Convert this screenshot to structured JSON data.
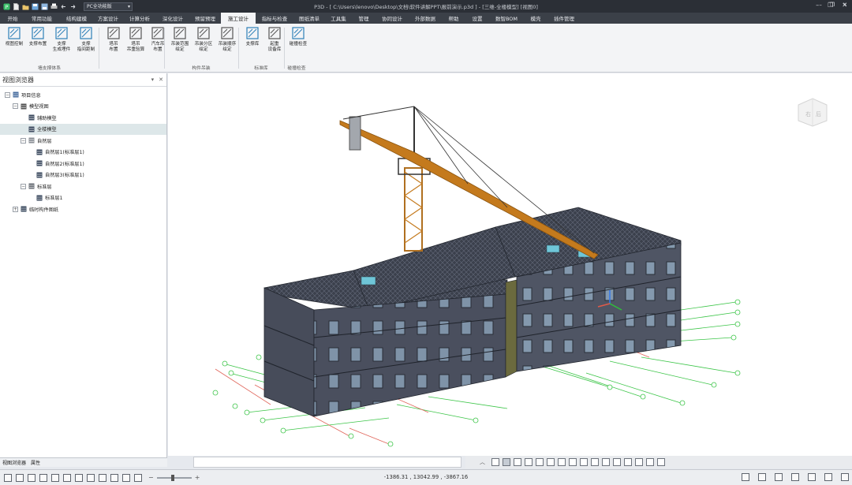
{
  "titlebar": {
    "workspace": "PC全功能版",
    "title": "P3D - [ C:\\Users\\lenovo\\Desktop\\文档\\软件讲解PPT\\报前演示.p3d ] - [三维-全楼模型] [视图0]"
  },
  "menu": {
    "tabs": [
      "开始",
      "常用功能",
      "结构建模",
      "方案设计",
      "计算分析",
      "深化设计",
      "预留预埋",
      "施工设计",
      "指标与检查",
      "图纸清单",
      "工具集",
      "管理",
      "协同设计",
      "外部数据",
      "帮助",
      "设置",
      "数智BOM",
      "模壳",
      "插件管理"
    ],
    "active": "施工设计"
  },
  "ribbon": {
    "buttons": [
      {
        "label": "视图控制",
        "icon": "view-control-icon"
      },
      {
        "label": "支撑布置",
        "icon": "support-layout-icon"
      },
      {
        "label": "支撑\n生成埋件",
        "icon": "support-embed-icon"
      },
      {
        "label": "支撑\n指间距制",
        "icon": "support-spacing-icon"
      },
      {
        "label": "塔吊\n布置",
        "icon": "tower-crane-icon"
      },
      {
        "label": "塔吊\n吊重验算",
        "icon": "crane-load-check-icon"
      },
      {
        "label": "汽车吊\n布置",
        "icon": "truck-crane-icon"
      },
      {
        "label": "吊装范围\n绘定",
        "icon": "hoist-range-icon"
      },
      {
        "label": "吊装分区\n绘定",
        "icon": "hoist-zone-icon"
      },
      {
        "label": "吊装顺序\n绘定",
        "icon": "hoist-order-icon"
      },
      {
        "label": "支撑库",
        "icon": "support-library-icon"
      },
      {
        "label": "起重\n设备库",
        "icon": "crane-equipment-library-icon"
      },
      {
        "label": "碰撞检查",
        "icon": "collision-check-icon"
      }
    ],
    "groups": [
      "墙支撑体系",
      "构件吊装",
      "标准库",
      "碰撞检查"
    ]
  },
  "browser": {
    "title": "视图浏览器",
    "tree": [
      {
        "label": "项目信息",
        "level": 0,
        "toggle": "⊟"
      },
      {
        "label": "模型视图",
        "level": 1,
        "toggle": "⊟"
      },
      {
        "label": "辅助模型",
        "level": 2,
        "toggle": ""
      },
      {
        "label": "全楼模型",
        "level": 2,
        "toggle": "",
        "selected": true
      },
      {
        "label": "自然层",
        "level": 2,
        "toggle": "⊟"
      },
      {
        "label": "自然层1(标准层1)",
        "level": 3,
        "toggle": ""
      },
      {
        "label": "自然层2(标准层1)",
        "level": 3,
        "toggle": ""
      },
      {
        "label": "自然层3(标准层1)",
        "level": 3,
        "toggle": ""
      },
      {
        "label": "标准层",
        "level": 2,
        "toggle": "⊟"
      },
      {
        "label": "标准层1",
        "level": 3,
        "toggle": ""
      },
      {
        "label": "临时构件图纸",
        "level": 1,
        "toggle": "⊞"
      }
    ],
    "tabs": [
      "视图浏览器",
      "属性"
    ]
  },
  "status": {
    "coords": "-1386.31 , 13042.99 , -3867.16"
  },
  "colors": {
    "titlebar": "#2b2f36",
    "menubar": "#3b4048",
    "building": "#4a4f5e",
    "crane": "#c77a1e",
    "axis_green": "#2fbf3a",
    "axis_red": "#e05a4a"
  }
}
